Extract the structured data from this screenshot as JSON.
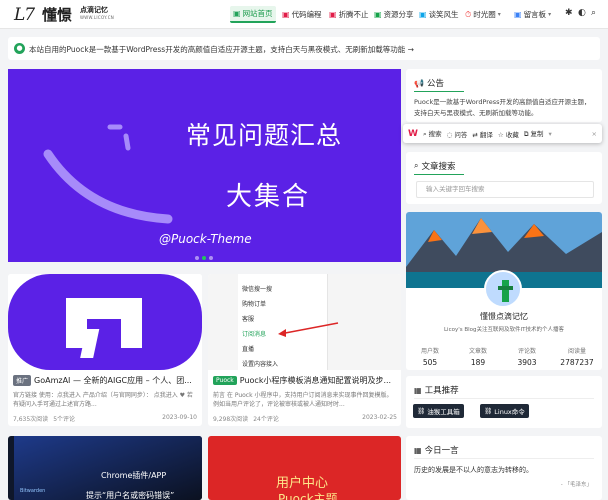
{
  "header": {
    "logo": {
      "mark": "L7",
      "name": "懂憬",
      "name2": "点滴记忆",
      "domain": "WWW.LICOY.CN"
    },
    "nav": [
      {
        "label": "网站首页",
        "icon": "home-icon"
      },
      {
        "label": "代码编程",
        "icon": "code-icon"
      },
      {
        "label": "折腾不止",
        "icon": "tools-icon"
      },
      {
        "label": "资源分享",
        "icon": "share-icon"
      },
      {
        "label": "谈笑风生",
        "icon": "chat-icon"
      },
      {
        "label": "时光圈",
        "icon": "clock-icon"
      },
      {
        "label": "留言板",
        "icon": "message-icon"
      }
    ]
  },
  "notice": {
    "text": "本站自用的Puock是一款基于WordPress开发的高颜值自适应开源主题，支持白天与黑夜模式、无刷新加载等功能 →"
  },
  "banner": {
    "line1": "常见问题汇总",
    "line2": "大集合",
    "line3": "@Puock-Theme"
  },
  "cards": [
    {
      "tag": "推广",
      "tag_color": "#6b7280",
      "title": "GoAmzAI — 全新的AIGC应用 – 个人、团...",
      "desc": "官方链接 使用：点我进入 产品介绍（与官网同步）： 点我进入 ♥ 若有疑问入手可通过上述官方路...",
      "views": "7,635次阅读",
      "comments": "5个评论",
      "date": "2023-09-10"
    },
    {
      "tag": "Puock",
      "tag_color": "#22a35a",
      "title": "Puock小程序模板消息通知配置说明及步...",
      "desc": "前言 在 Puock 小程序中，支持用户订阅消息来实现事件回复模版。例如当用户评论了，评论被审核或被人通知时时...",
      "views": "9,298次阅读",
      "comments": "24个评论",
      "date": "2023-02-25"
    },
    {
      "label": "Chrome插件/APP",
      "caption": "提示“用户名或密码错误”",
      "brand": "Bitwarden"
    },
    {
      "line1": "用户中心",
      "line2": "Puock主题"
    }
  ],
  "phone_menu": [
    "微信搜一搜",
    "购物订单",
    "客服",
    "订阅消息",
    "直播",
    "设置内容接入"
  ],
  "toolbar": {
    "logo": "W",
    "items": [
      "搜索",
      "问答",
      "翻译",
      "收藏",
      "复制"
    ]
  },
  "sidebar": {
    "announcement": {
      "title": "公告",
      "text": "Puock是一款基于WordPress开发的高颜值自适应开源主题，支持白天与黑夜模式、无刷新加载等功能。"
    },
    "search": {
      "title": "文章搜索",
      "placeholder": "输入关键字回车搜索"
    },
    "profile": {
      "name": "懂憬点滴记忆",
      "bio": "Licoy's Blog关注互联网及软件IT技术的个人播客",
      "stats": [
        {
          "label": "用户数",
          "value": "505"
        },
        {
          "label": "文章数",
          "value": "189"
        },
        {
          "label": "评论数",
          "value": "3903"
        },
        {
          "label": "阅读量",
          "value": "2787237"
        }
      ]
    },
    "tools": {
      "title": "工具推荐",
      "buttons": [
        "油猴工具箱",
        "Linux命令"
      ]
    },
    "daily": {
      "title": "今日一言",
      "quote": "历史的发展是不以人的意志为转移的。",
      "source": "- 「毛泽东」"
    }
  },
  "colors": {
    "accent": "#22a35a",
    "banner": "#5b21e6"
  }
}
